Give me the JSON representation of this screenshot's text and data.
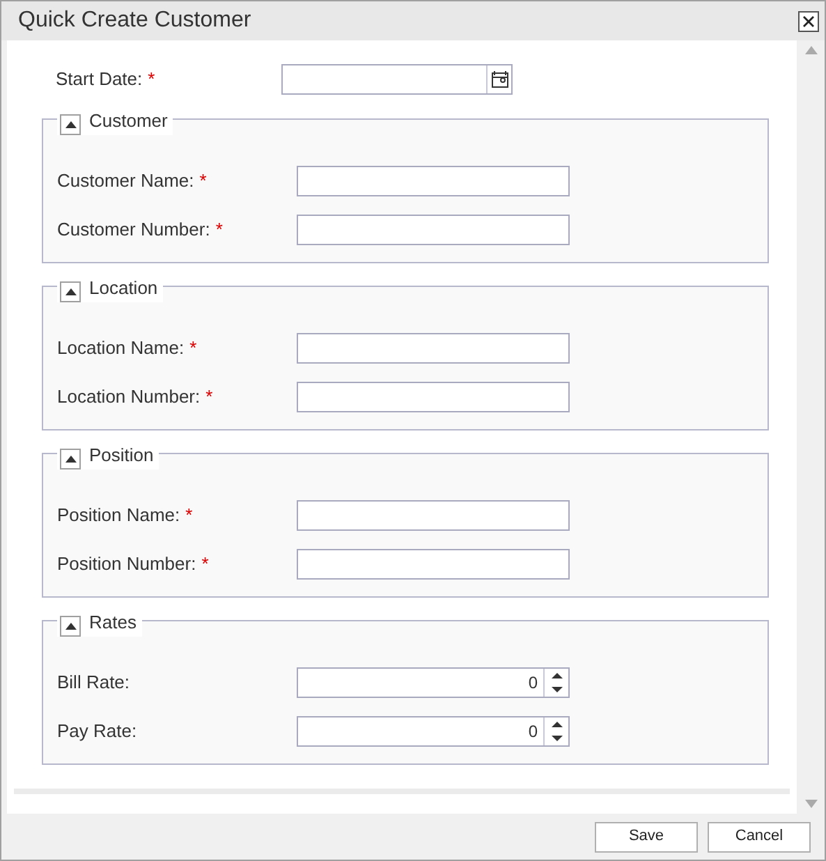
{
  "window": {
    "title": "Quick Create Customer"
  },
  "start_date": {
    "label": "Start Date:",
    "required_mark": "*"
  },
  "sections": [
    {
      "title": "Customer",
      "expanded": true,
      "fields": [
        {
          "kind": "text",
          "label": "Customer Name:",
          "required_mark": "*"
        },
        {
          "kind": "text",
          "label": "Customer Number:",
          "required_mark": "*"
        }
      ]
    },
    {
      "title": "Location",
      "expanded": true,
      "fields": [
        {
          "kind": "text",
          "label": "Location Name:",
          "required_mark": "*"
        },
        {
          "kind": "text",
          "label": "Location Number:",
          "required_mark": "*"
        }
      ]
    },
    {
      "title": "Position",
      "expanded": true,
      "fields": [
        {
          "kind": "text",
          "label": "Position Name:",
          "required_mark": "*"
        },
        {
          "kind": "text",
          "label": "Position Number:",
          "required_mark": "*"
        }
      ]
    },
    {
      "title": "Rates",
      "expanded": true,
      "fields": [
        {
          "kind": "number",
          "label": "Bill Rate:",
          "value": "0"
        },
        {
          "kind": "number",
          "label": "Pay Rate:",
          "value": "0"
        }
      ]
    }
  ],
  "buttons": [
    "Save",
    "Cancel"
  ]
}
